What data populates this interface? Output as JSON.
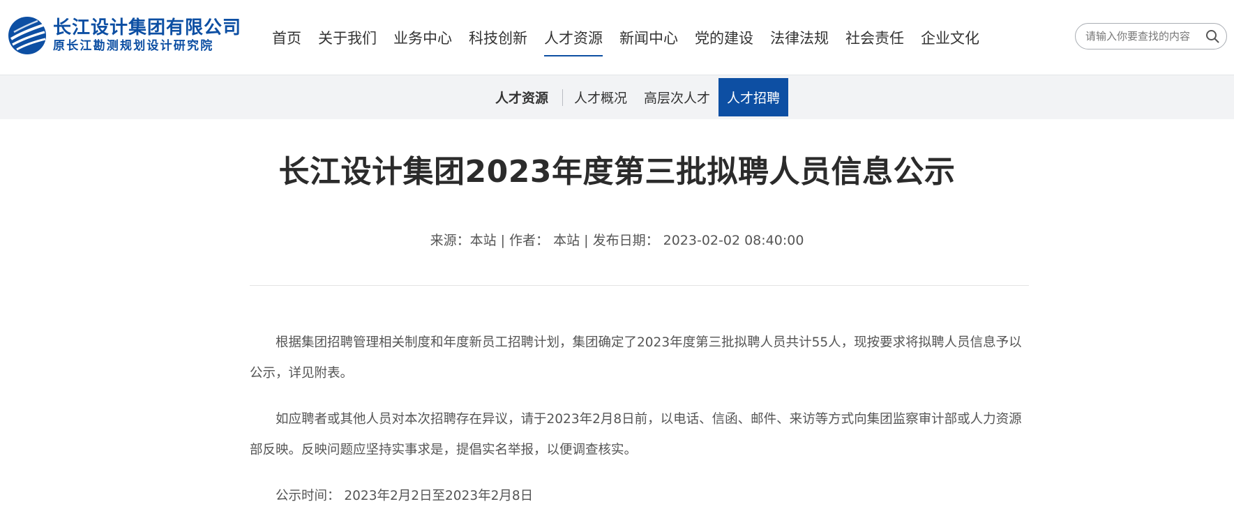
{
  "header": {
    "logo": {
      "name": "长江设计集团有限公司",
      "subtitle": "原长江勘测规划设计研究院"
    },
    "nav": [
      {
        "label": "首页"
      },
      {
        "label": "关于我们"
      },
      {
        "label": "业务中心"
      },
      {
        "label": "科技创新"
      },
      {
        "label": "人才资源",
        "active": true
      },
      {
        "label": "新闻中心"
      },
      {
        "label": "党的建设"
      },
      {
        "label": "法律法规"
      },
      {
        "label": "社会责任"
      },
      {
        "label": "企业文化"
      }
    ],
    "search": {
      "placeholder": "请输入你要查找的内容",
      "icon": "search-icon"
    }
  },
  "subnav": {
    "title": "人才资源",
    "items": [
      {
        "label": "人才概况"
      },
      {
        "label": "高层次人才"
      },
      {
        "label": "人才招聘",
        "active": true
      }
    ]
  },
  "article": {
    "title": "长江设计集团2023年度第三批拟聘人员信息公示",
    "meta": "来源：本站 | 作者： 本站 | 发布日期： 2023-02-02 08:40:00",
    "paragraphs": [
      "根据集团招聘管理相关制度和年度新员工招聘计划，集团确定了2023年度第三批拟聘人员共计55人，现按要求将拟聘人员信息予以公示，详见附表。",
      "如应聘者或其他人员对本次招聘存在异议，请于2023年2月8日前，以电话、信函、邮件、来访等方式向集团监察审计部或人力资源部反映。反映问题应坚持实事求是，提倡实名举报，以便调查核实。",
      "公示时间： 2023年2月2日至2023年2月8日"
    ]
  },
  "colors": {
    "brand": "#0d4fa3",
    "subnav_bg": "#f2f3f5",
    "text": "#333333"
  }
}
